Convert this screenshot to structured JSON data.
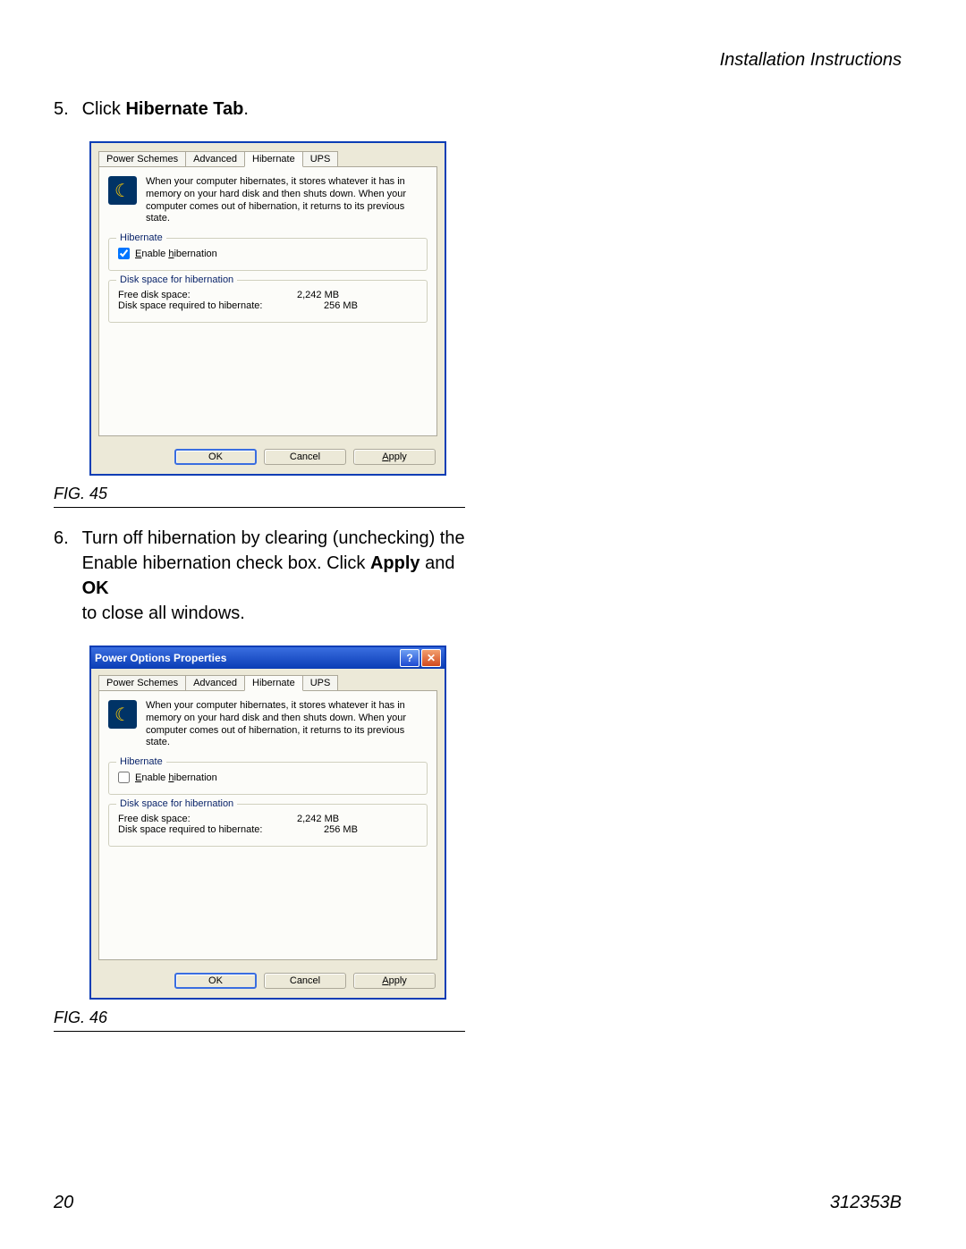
{
  "header": {
    "section": "Installation Instructions"
  },
  "steps": {
    "s5": {
      "num": "5.",
      "prefix": "Click ",
      "bold": "Hibernate Tab",
      "suffix": "."
    },
    "s6": {
      "num": "6.",
      "line1a": "Turn off hibernation by clearing (unchecking) the",
      "line2a": "Enable hibernation check box. Click ",
      "apply": "Apply",
      "and": " and ",
      "ok": "OK",
      "line3": "to close all windows."
    }
  },
  "captions": {
    "fig45": "FIG. 45",
    "fig46": "FIG. 46"
  },
  "dialog": {
    "title": "Power Options Properties",
    "tabs": {
      "t1": "Power Schemes",
      "t2": "Advanced",
      "t3": "Hibernate",
      "t4": "UPS"
    },
    "description": "When your computer hibernates, it stores whatever it has in memory on your hard disk and then shuts down. When your computer comes out of hibernation, it returns to its previous state.",
    "group_hibernate": "Hibernate",
    "enable_label_pre": "E",
    "enable_label_rest": "nable ",
    "enable_label_h": "h",
    "enable_label_end": "ibernation",
    "group_disk": "Disk space for hibernation",
    "free_label": "Free disk space:",
    "free_value": "2,242 MB",
    "req_label": "Disk space required to hibernate:",
    "req_value": "256 MB",
    "buttons": {
      "ok": "OK",
      "cancel": "Cancel",
      "apply_pre": "A",
      "apply_rest": "pply"
    }
  },
  "footer": {
    "page": "20",
    "docnum": "312353B"
  }
}
